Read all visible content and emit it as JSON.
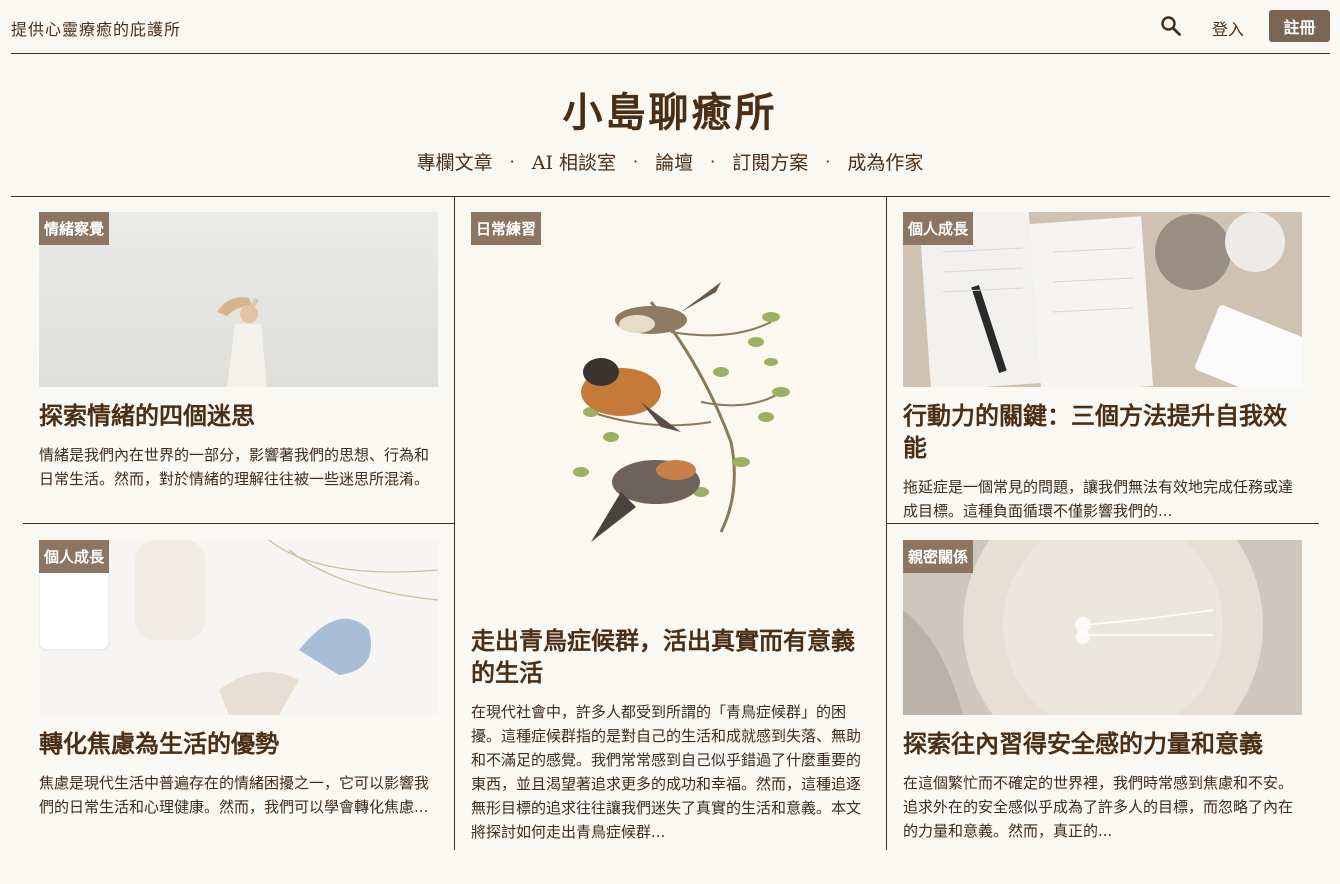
{
  "header": {
    "tagline": "提供心靈療癒的庇護所",
    "login_label": "登入",
    "signup_label": "註冊",
    "search_icon": "search-icon"
  },
  "site": {
    "title": "小島聊癒所"
  },
  "nav": {
    "items": [
      "專欄文章",
      "AI 相談室",
      "論壇",
      "訂閱方案",
      "成為作家"
    ],
    "separator": "·"
  },
  "articles": [
    {
      "tag": "情緒察覺",
      "title": "探索情緒的四個迷思",
      "excerpt": "情緒是我們內在世界的一部分，影響著我們的思想、行為和日常生活。然而，對於情緒的理解往往被一些迷思所混淆。"
    },
    {
      "tag": "日常練習",
      "title": "走出青鳥症候群，活出真實而有意義的生活",
      "excerpt": "在現代社會中，許多人都受到所謂的「青鳥症候群」的困擾。這種症候群指的是對自己的生活和成就感到失落、無助和不滿足的感覺。我們常常感到自己似乎錯過了什麼重要的東西，並且渴望著追求更多的成功和幸福。然而，這種追逐無形目標的追求往往讓我們迷失了真實的生活和意義。本文將探討如何走出青鳥症候群..."
    },
    {
      "tag": "個人成長",
      "title": "行動力的關鍵：三個方法提升自我效能",
      "excerpt": "拖延症是一個常見的問題，讓我們無法有效地完成任務或達成目標。這種負面循環不僅影響我們的..."
    },
    {
      "tag": "個人成長",
      "title": "轉化焦慮為生活的優勢",
      "excerpt": "焦慮是現代生活中普遍存在的情緒困擾之一，它可以影響我們的日常生活和心理健康。然而，我們可以學會轉化焦慮..."
    },
    {
      "tag": "親密關係",
      "title": "探索往內習得安全感的力量和意義",
      "excerpt": "在這個繁忙而不確定的世界裡，我們時常感到焦慮和不安。追求外在的安全感似乎成為了許多人的目標，而忽略了內在的力量和意義。然而，真正的..."
    }
  ],
  "colors": {
    "background": "#faf8f3",
    "text": "#4a2f16",
    "tag_bg": "#8c7563",
    "signup_bg": "#7a6454"
  }
}
